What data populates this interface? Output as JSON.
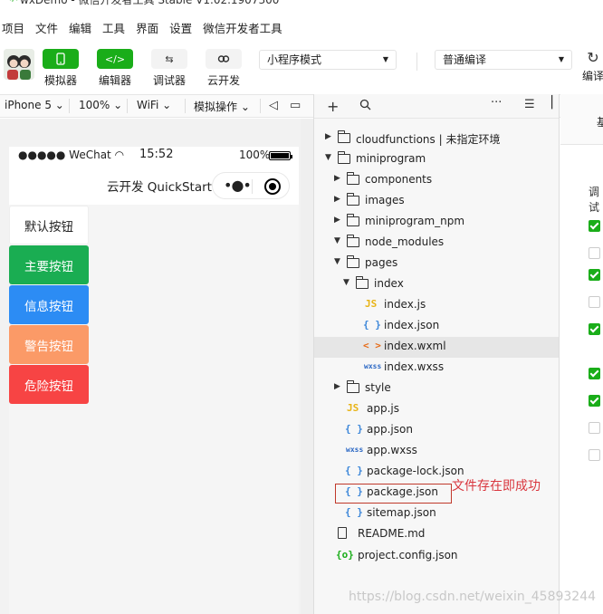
{
  "window": {
    "title": "wxDemo - 微信开发者工具 Stable V1.02.1907300"
  },
  "menu": [
    "项目",
    "文件",
    "编辑",
    "工具",
    "界面",
    "设置",
    "微信开发者工具"
  ],
  "toolbar": {
    "simulator_label": "模拟器",
    "editor_label": "编辑器",
    "debugger_label": "调试器",
    "cloud_label": "云开发",
    "mode_select": "小程序模式",
    "compile_select": "普通编译",
    "compile_label": "编译"
  },
  "subbar": {
    "device": "iPhone 5",
    "zoom": "100%",
    "network": "WiFi",
    "sim_ops": "模拟操作"
  },
  "phone": {
    "carrier": "●●●●● WeChat",
    "time": "15:52",
    "battery": "100%",
    "nav_title": "云开发 QuickStart",
    "buttons": {
      "default": "默认按钮",
      "primary": "主要按钮",
      "info": "信息按钮",
      "warn": "警告按钮",
      "danger": "危险按钮"
    }
  },
  "tree": [
    {
      "name": "cloudfunctions | 未指定环境",
      "type": "folder-cloud",
      "expanded": false
    },
    {
      "name": "miniprogram",
      "type": "folder",
      "expanded": true
    },
    {
      "name": "components",
      "type": "folder",
      "expanded": false
    },
    {
      "name": "images",
      "type": "folder",
      "expanded": false
    },
    {
      "name": "miniprogram_npm",
      "type": "folder",
      "expanded": false
    },
    {
      "name": "node_modules",
      "type": "folder",
      "expanded": true
    },
    {
      "name": "pages",
      "type": "folder",
      "expanded": true
    },
    {
      "name": "index",
      "type": "folder",
      "expanded": true
    },
    {
      "name": "index.js",
      "type": "js"
    },
    {
      "name": "index.json",
      "type": "json"
    },
    {
      "name": "index.wxml",
      "type": "wxml",
      "selected": true
    },
    {
      "name": "index.wxss",
      "type": "wxss"
    },
    {
      "name": "style",
      "type": "folder",
      "expanded": false
    },
    {
      "name": "app.js",
      "type": "js"
    },
    {
      "name": "app.json",
      "type": "json"
    },
    {
      "name": "app.wxss",
      "type": "wxss"
    },
    {
      "name": "package-lock.json",
      "type": "json"
    },
    {
      "name": "package.json",
      "type": "json"
    },
    {
      "name": "sitemap.json",
      "type": "json"
    },
    {
      "name": "README.md",
      "type": "doc"
    },
    {
      "name": "project.config.json",
      "type": "proj"
    }
  ],
  "icons": {
    "js": "JS",
    "json": "{ }",
    "wxml": "< >",
    "wxss": "wxss",
    "proj": "{o}"
  },
  "annotation": "文件存在即成功",
  "right_panel": {
    "tab": "基",
    "label": "调试",
    "checkboxes": [
      true,
      false,
      true,
      false,
      true,
      true,
      true,
      false,
      false
    ]
  },
  "watermark": "https://blog.csdn.net/weixin_45893244",
  "colors": {
    "accent_green": "#1aad19",
    "primary": "#1aad52",
    "info": "#2c8cf4",
    "warn": "#fb9a67",
    "danger": "#f74444",
    "annotation": "#d9363e"
  }
}
